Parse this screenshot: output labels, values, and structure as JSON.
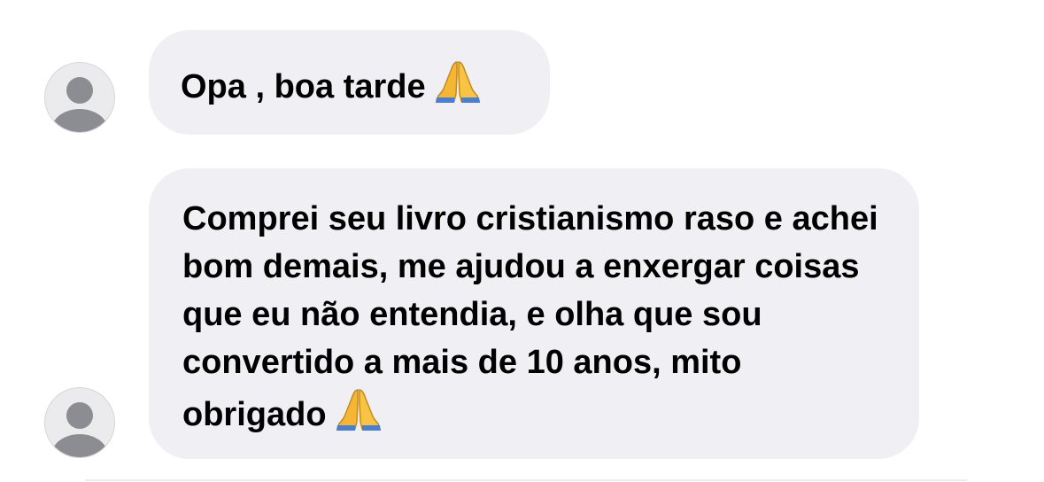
{
  "messages": [
    {
      "text": "Opa , boa tarde",
      "emoji": "folded-hands"
    },
    {
      "text": "Comprei seu livro cristianismo raso e achei bom demais, me ajudou a enxergar coisas que eu não entendia, e olha que sou convertido a mais de 10 anos, mito obrigado",
      "emoji": "folded-hands"
    }
  ],
  "colors": {
    "bubble_bg": "#f0f0f4",
    "avatar_bg": "#ebebee",
    "avatar_fg": "#8b8d93",
    "text": "#000000"
  }
}
